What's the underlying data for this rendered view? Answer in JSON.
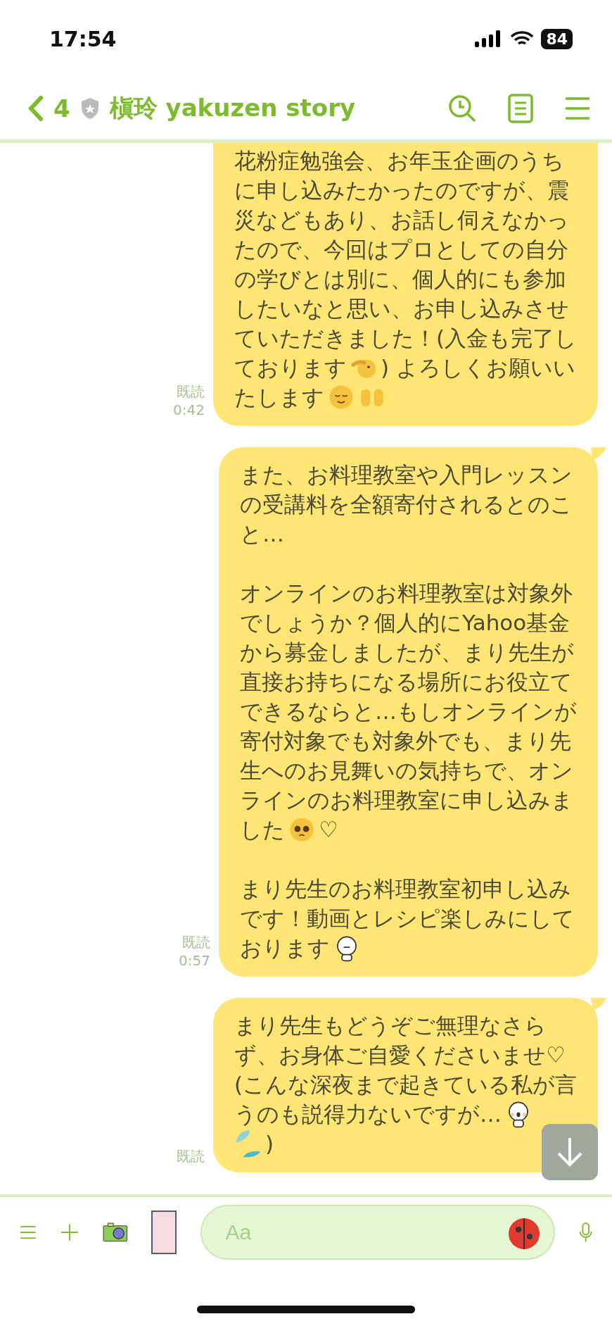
{
  "status_bar": {
    "time": "17:54",
    "battery": "84"
  },
  "header": {
    "back_count": "4",
    "title": "槇玲 yakuzen story"
  },
  "messages": [
    {
      "tail": false,
      "read": "既読",
      "time": "0:42",
      "paragraphs": [
        [
          [
            {
              "kind": "text",
              "text": "花粉症勉強会、お年玉企画のうち"
            }
          ],
          [
            {
              "kind": "text",
              "text": "に申し込みたかったのですが、震"
            }
          ],
          [
            {
              "kind": "text",
              "text": "災などもあり、お話し伺えなかっ"
            }
          ],
          [
            {
              "kind": "text",
              "text": "たので、今回はプロとしての自分"
            }
          ],
          [
            {
              "kind": "text",
              "text": "の学びとは別に、個人的にも参加"
            }
          ],
          [
            {
              "kind": "text",
              "text": "したいなと思い、お申し込みさせ"
            }
          ],
          [
            {
              "kind": "text",
              "text": "ていただきました！(入金も完了し"
            }
          ],
          [
            {
              "kind": "text",
              "text": "ております"
            },
            {
              "kind": "salute"
            },
            {
              "kind": "text",
              "text": ") よろしくお願いい"
            }
          ],
          [
            {
              "kind": "text",
              "text": "たします"
            },
            {
              "kind": "relieved"
            },
            {
              "kind": "hands"
            }
          ]
        ]
      ]
    },
    {
      "tail": true,
      "read": "既読",
      "time": "0:57",
      "paragraphs": [
        [
          [
            {
              "kind": "text",
              "text": "また、お料理教室や入門レッスン"
            }
          ],
          [
            {
              "kind": "text",
              "text": "の受講料を全額寄付されるとのこ"
            }
          ],
          [
            {
              "kind": "text",
              "text": "と…"
            }
          ]
        ],
        [
          [
            {
              "kind": "text",
              "text": "オンラインのお料理教室は対象外"
            }
          ],
          [
            {
              "kind": "text",
              "text": "でしょうか？個人的にYahoo基金"
            }
          ],
          [
            {
              "kind": "text",
              "text": "から募金しましたが、まり先生が"
            }
          ],
          [
            {
              "kind": "text",
              "text": "直接お持ちになる場所にお役立て"
            }
          ],
          [
            {
              "kind": "text",
              "text": "できるならと…もしオンラインが"
            }
          ],
          [
            {
              "kind": "text",
              "text": "寄付対象でも対象外でも、まり先"
            }
          ],
          [
            {
              "kind": "text",
              "text": "生へのお見舞いの気持ちで、オン"
            }
          ],
          [
            {
              "kind": "text",
              "text": "ラインのお料理教室に申し込みま"
            }
          ],
          [
            {
              "kind": "text",
              "text": "した"
            },
            {
              "kind": "pleading"
            },
            {
              "kind": "text",
              "text": "♡"
            }
          ]
        ],
        [
          [
            {
              "kind": "text",
              "text": "まり先生のお料理教室初申し込み"
            }
          ],
          [
            {
              "kind": "text",
              "text": "です！動画とレシピ楽しみにして"
            }
          ],
          [
            {
              "kind": "text",
              "text": "おります"
            },
            {
              "kind": "bow"
            }
          ]
        ]
      ]
    },
    {
      "tail": true,
      "read": "既読",
      "paragraphs": [
        [
          [
            {
              "kind": "text",
              "text": "まり先生もどうぞご無理なさら"
            }
          ],
          [
            {
              "kind": "text",
              "text": "ず、お身体ご自愛くださいませ♡"
            }
          ],
          [
            {
              "kind": "text",
              "text": "(こんな深夜まで起きている私が言"
            }
          ],
          [
            {
              "kind": "text",
              "text": "うのも説得力ないですが…"
            },
            {
              "kind": "laugh"
            }
          ],
          [
            {
              "kind": "drops"
            },
            {
              "kind": "text",
              "text": ")"
            }
          ]
        ]
      ]
    }
  ],
  "composer": {
    "placeholder": "Aa"
  }
}
